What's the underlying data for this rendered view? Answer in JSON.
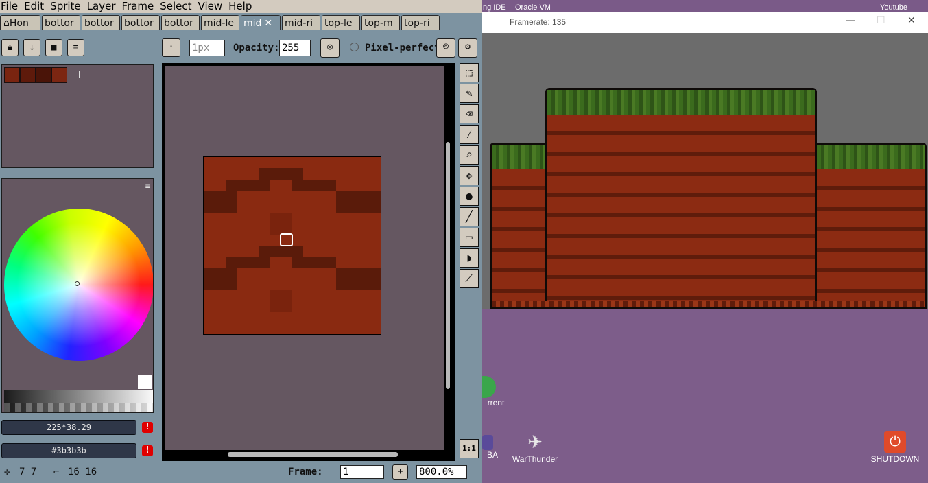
{
  "menu": [
    "File",
    "Edit",
    "Sprite",
    "Layer",
    "Frame",
    "Select",
    "View",
    "Help"
  ],
  "tabs": [
    {
      "label": "Hon",
      "home": true
    },
    {
      "label": "bottor"
    },
    {
      "label": "bottor"
    },
    {
      "label": "bottor"
    },
    {
      "label": "bottor"
    },
    {
      "label": "mid-le"
    },
    {
      "label": "mid",
      "active": true,
      "close": "✕"
    },
    {
      "label": "mid-ri"
    },
    {
      "label": "top-le"
    },
    {
      "label": "top-m"
    },
    {
      "label": "top-ri"
    }
  ],
  "toolbar": {
    "brush_size": "1px",
    "opacity_label": "Opacity:",
    "opacity_value": "255",
    "pixel_perfect_label": "Pixel-perfect"
  },
  "palette": {
    "swatches": [
      "#7a2410",
      "#5e1a0b",
      "#4a1408",
      "#7c2612"
    ]
  },
  "color_info": {
    "hsv": "225*38.29",
    "hex": "#3b3b3b",
    "warn_glyph": "!"
  },
  "status": {
    "cursor": "7 7",
    "size": "16 16",
    "frame_label": "Frame:",
    "frame_value": "1",
    "add_glyph": "+",
    "zoom": "800.0%"
  },
  "one_to_one": "1:1",
  "game_window": {
    "title": "Framerate: 135",
    "minimize": "—",
    "maximize": "☐",
    "close": "✕"
  },
  "desktop": {
    "top_labels": [
      "ng IDE",
      "Oracle VM",
      "Youtube"
    ],
    "icons": [
      {
        "label": "rrent",
        "color": "#3aa64a"
      },
      {
        "label": "BA",
        "color": "#5a4a9a"
      },
      {
        "label": "WarThunder",
        "color": "#d8d8d8"
      },
      {
        "label": "SHUTDOWN",
        "color": "#e04a2a"
      }
    ]
  },
  "colors": {
    "accent": "#7d93a1",
    "menu_bg": "#d3cbbf",
    "canvas_bg": "#655761",
    "sprite_base": "#8a2a11",
    "grass": "#3b6b1d"
  }
}
